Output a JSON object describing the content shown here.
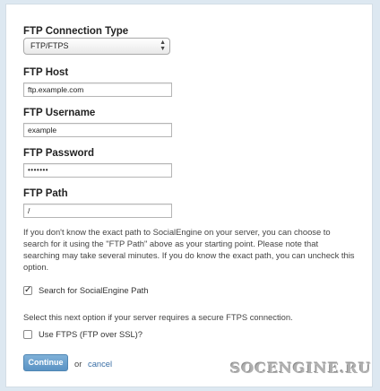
{
  "form": {
    "connection_type_label": "FTP Connection Type",
    "connection_type_value": "FTP/FTPS",
    "host_label": "FTP Host",
    "host_value": "ftp.example.com",
    "username_label": "FTP Username",
    "username_value": "example",
    "password_label": "FTP Password",
    "password_value": "•••••••",
    "path_label": "FTP Path",
    "path_value": "/",
    "path_description": "If you don't know the exact path to SocialEngine on your server, you can choose to search for it using the \"FTP Path\" above as your starting point. Please note that searching may take several minutes. If you do know the exact path, you can uncheck this option.",
    "search_checkbox_label": "Search for SocialEngine Path",
    "search_checked": true,
    "ftps_note": "Select this next option if your server requires a secure FTPS connection.",
    "ftps_checkbox_label": "Use FTPS (FTP over SSL)?",
    "ftps_checked": false,
    "continue_label": "Continue",
    "or_text": "or",
    "cancel_label": "cancel"
  },
  "watermark": "SOCENGINE.RU",
  "colors": {
    "background": "#dde8f1",
    "panel": "#ffffff",
    "button": "#6aa1cf",
    "link": "#3a6fa6"
  }
}
